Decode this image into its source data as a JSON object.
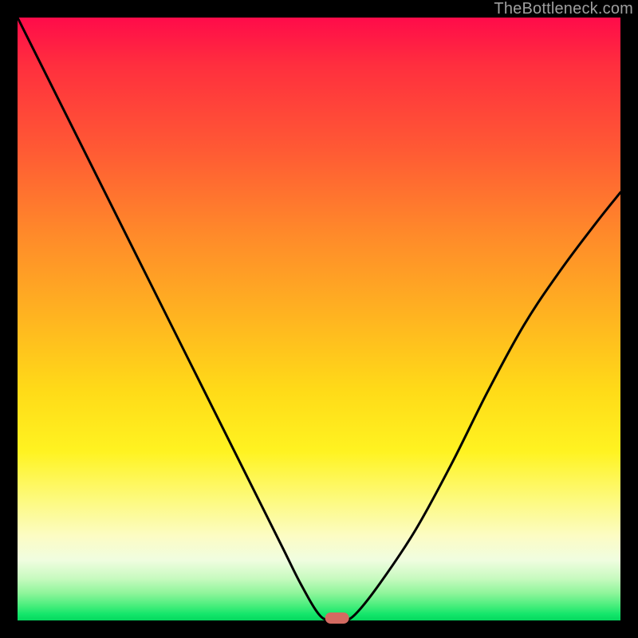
{
  "watermark": "TheBottleneck.com",
  "chart_data": {
    "type": "line",
    "title": "",
    "xlabel": "",
    "ylabel": "",
    "xlim": [
      0,
      100
    ],
    "ylim": [
      0,
      100
    ],
    "grid": false,
    "legend": false,
    "annotations": [],
    "series": [
      {
        "name": "bottleneck-curve",
        "x": [
          0,
          4,
          8,
          12,
          16,
          20,
          24,
          28,
          32,
          36,
          40,
          44,
          47,
          50,
          52,
          54,
          56,
          60,
          66,
          72,
          78,
          84,
          90,
          96,
          100
        ],
        "y": [
          100,
          92,
          84,
          76,
          68,
          60,
          52,
          44,
          36,
          28,
          20,
          12,
          6,
          1,
          0,
          0,
          1,
          6,
          15,
          26,
          38,
          49,
          58,
          66,
          71
        ]
      }
    ],
    "marker": {
      "name": "optimum-marker",
      "x": 53,
      "y": 0,
      "shape": "pill",
      "color": "#d46a61"
    },
    "background_gradient": {
      "direction": "vertical",
      "stops": [
        {
          "pos": 0,
          "color": "#ff0b4a"
        },
        {
          "pos": 50,
          "color": "#ffb520"
        },
        {
          "pos": 80,
          "color": "#fdfa7e"
        },
        {
          "pos": 100,
          "color": "#06d85f"
        }
      ]
    }
  }
}
